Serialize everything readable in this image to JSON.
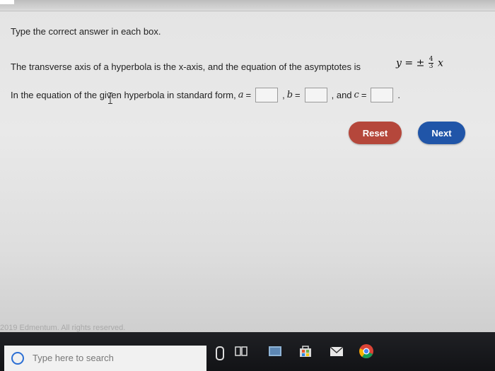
{
  "instruction": "Type the correct answer in each box.",
  "question": {
    "text": "The transverse axis of a hyperbola is the x-axis, and the equation of the asymptotes is",
    "equation": {
      "lhs": "y",
      "equals": "=",
      "pm": "±",
      "num": "4",
      "den": "3",
      "var": "x"
    }
  },
  "prompt": {
    "text": "In the equation of the given hyperbola in standard form,",
    "a_label": "a",
    "b_label": "b",
    "c_label": "c",
    "eq": "=",
    "comma": ",",
    "and": ", and",
    "period": ".",
    "a_value": "",
    "b_value": "",
    "c_value": ""
  },
  "buttons": {
    "reset": "Reset",
    "next": "Next"
  },
  "footer": {
    "copyright": "2019 Edmentum. All rights reserved."
  },
  "taskbar": {
    "search_placeholder": "Type here to search"
  },
  "colors": {
    "reset": "#b5473b",
    "next": "#2055a8"
  }
}
